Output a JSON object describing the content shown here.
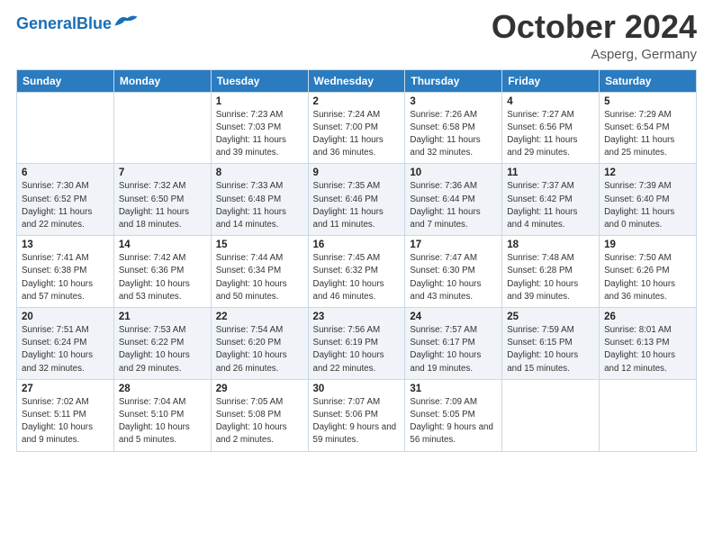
{
  "header": {
    "logo_general": "General",
    "logo_blue": "Blue",
    "month_title": "October 2024",
    "location": "Asperg, Germany"
  },
  "weekdays": [
    "Sunday",
    "Monday",
    "Tuesday",
    "Wednesday",
    "Thursday",
    "Friday",
    "Saturday"
  ],
  "weeks": [
    [
      {
        "num": "",
        "info": ""
      },
      {
        "num": "",
        "info": ""
      },
      {
        "num": "1",
        "info": "Sunrise: 7:23 AM\nSunset: 7:03 PM\nDaylight: 11 hours and 39 minutes."
      },
      {
        "num": "2",
        "info": "Sunrise: 7:24 AM\nSunset: 7:00 PM\nDaylight: 11 hours and 36 minutes."
      },
      {
        "num": "3",
        "info": "Sunrise: 7:26 AM\nSunset: 6:58 PM\nDaylight: 11 hours and 32 minutes."
      },
      {
        "num": "4",
        "info": "Sunrise: 7:27 AM\nSunset: 6:56 PM\nDaylight: 11 hours and 29 minutes."
      },
      {
        "num": "5",
        "info": "Sunrise: 7:29 AM\nSunset: 6:54 PM\nDaylight: 11 hours and 25 minutes."
      }
    ],
    [
      {
        "num": "6",
        "info": "Sunrise: 7:30 AM\nSunset: 6:52 PM\nDaylight: 11 hours and 22 minutes."
      },
      {
        "num": "7",
        "info": "Sunrise: 7:32 AM\nSunset: 6:50 PM\nDaylight: 11 hours and 18 minutes."
      },
      {
        "num": "8",
        "info": "Sunrise: 7:33 AM\nSunset: 6:48 PM\nDaylight: 11 hours and 14 minutes."
      },
      {
        "num": "9",
        "info": "Sunrise: 7:35 AM\nSunset: 6:46 PM\nDaylight: 11 hours and 11 minutes."
      },
      {
        "num": "10",
        "info": "Sunrise: 7:36 AM\nSunset: 6:44 PM\nDaylight: 11 hours and 7 minutes."
      },
      {
        "num": "11",
        "info": "Sunrise: 7:37 AM\nSunset: 6:42 PM\nDaylight: 11 hours and 4 minutes."
      },
      {
        "num": "12",
        "info": "Sunrise: 7:39 AM\nSunset: 6:40 PM\nDaylight: 11 hours and 0 minutes."
      }
    ],
    [
      {
        "num": "13",
        "info": "Sunrise: 7:41 AM\nSunset: 6:38 PM\nDaylight: 10 hours and 57 minutes."
      },
      {
        "num": "14",
        "info": "Sunrise: 7:42 AM\nSunset: 6:36 PM\nDaylight: 10 hours and 53 minutes."
      },
      {
        "num": "15",
        "info": "Sunrise: 7:44 AM\nSunset: 6:34 PM\nDaylight: 10 hours and 50 minutes."
      },
      {
        "num": "16",
        "info": "Sunrise: 7:45 AM\nSunset: 6:32 PM\nDaylight: 10 hours and 46 minutes."
      },
      {
        "num": "17",
        "info": "Sunrise: 7:47 AM\nSunset: 6:30 PM\nDaylight: 10 hours and 43 minutes."
      },
      {
        "num": "18",
        "info": "Sunrise: 7:48 AM\nSunset: 6:28 PM\nDaylight: 10 hours and 39 minutes."
      },
      {
        "num": "19",
        "info": "Sunrise: 7:50 AM\nSunset: 6:26 PM\nDaylight: 10 hours and 36 minutes."
      }
    ],
    [
      {
        "num": "20",
        "info": "Sunrise: 7:51 AM\nSunset: 6:24 PM\nDaylight: 10 hours and 32 minutes."
      },
      {
        "num": "21",
        "info": "Sunrise: 7:53 AM\nSunset: 6:22 PM\nDaylight: 10 hours and 29 minutes."
      },
      {
        "num": "22",
        "info": "Sunrise: 7:54 AM\nSunset: 6:20 PM\nDaylight: 10 hours and 26 minutes."
      },
      {
        "num": "23",
        "info": "Sunrise: 7:56 AM\nSunset: 6:19 PM\nDaylight: 10 hours and 22 minutes."
      },
      {
        "num": "24",
        "info": "Sunrise: 7:57 AM\nSunset: 6:17 PM\nDaylight: 10 hours and 19 minutes."
      },
      {
        "num": "25",
        "info": "Sunrise: 7:59 AM\nSunset: 6:15 PM\nDaylight: 10 hours and 15 minutes."
      },
      {
        "num": "26",
        "info": "Sunrise: 8:01 AM\nSunset: 6:13 PM\nDaylight: 10 hours and 12 minutes."
      }
    ],
    [
      {
        "num": "27",
        "info": "Sunrise: 7:02 AM\nSunset: 5:11 PM\nDaylight: 10 hours and 9 minutes."
      },
      {
        "num": "28",
        "info": "Sunrise: 7:04 AM\nSunset: 5:10 PM\nDaylight: 10 hours and 5 minutes."
      },
      {
        "num": "29",
        "info": "Sunrise: 7:05 AM\nSunset: 5:08 PM\nDaylight: 10 hours and 2 minutes."
      },
      {
        "num": "30",
        "info": "Sunrise: 7:07 AM\nSunset: 5:06 PM\nDaylight: 9 hours and 59 minutes."
      },
      {
        "num": "31",
        "info": "Sunrise: 7:09 AM\nSunset: 5:05 PM\nDaylight: 9 hours and 56 minutes."
      },
      {
        "num": "",
        "info": ""
      },
      {
        "num": "",
        "info": ""
      }
    ]
  ]
}
